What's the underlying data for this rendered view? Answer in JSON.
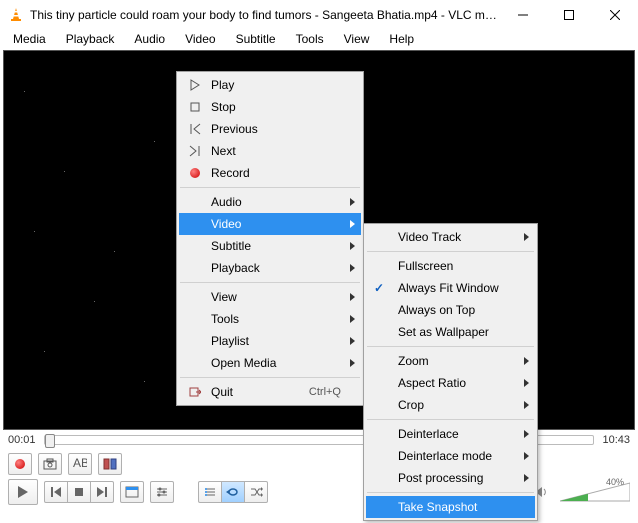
{
  "window": {
    "title": "This tiny particle could roam your body to find tumors - Sangeeta Bhatia.mp4 - VLC me..."
  },
  "menubar": [
    "Media",
    "Playback",
    "Audio",
    "Video",
    "Subtitle",
    "Tools",
    "View",
    "Help"
  ],
  "time": {
    "current": "00:01",
    "total": "10:43"
  },
  "volume": {
    "label": "40%",
    "value": 40
  },
  "context_main": {
    "items": [
      {
        "icon": "play",
        "label": "Play"
      },
      {
        "icon": "stop",
        "label": "Stop"
      },
      {
        "icon": "prev",
        "label": "Previous"
      },
      {
        "icon": "next",
        "label": "Next"
      },
      {
        "icon": "rec",
        "label": "Record"
      },
      {
        "sep": true
      },
      {
        "label": "Audio",
        "submenu": true
      },
      {
        "label": "Video",
        "submenu": true,
        "highlight": true
      },
      {
        "label": "Subtitle",
        "submenu": true
      },
      {
        "label": "Playback",
        "submenu": true
      },
      {
        "sep": true
      },
      {
        "label": "View",
        "submenu": true
      },
      {
        "label": "Tools",
        "submenu": true
      },
      {
        "label": "Playlist",
        "submenu": true
      },
      {
        "label": "Open Media",
        "submenu": true
      },
      {
        "sep": true
      },
      {
        "icon": "quit",
        "label": "Quit",
        "shortcut": "Ctrl+Q"
      }
    ]
  },
  "context_sub": {
    "items": [
      {
        "label": "Video Track",
        "submenu": true
      },
      {
        "sep": true
      },
      {
        "label": "Fullscreen"
      },
      {
        "label": "Always Fit Window",
        "checked": true
      },
      {
        "label": "Always on Top"
      },
      {
        "label": "Set as Wallpaper"
      },
      {
        "sep": true
      },
      {
        "label": "Zoom",
        "submenu": true
      },
      {
        "label": "Aspect Ratio",
        "submenu": true
      },
      {
        "label": "Crop",
        "submenu": true
      },
      {
        "sep": true
      },
      {
        "label": "Deinterlace",
        "submenu": true
      },
      {
        "label": "Deinterlace mode",
        "submenu": true
      },
      {
        "label": "Post processing",
        "submenu": true
      },
      {
        "sep": true
      },
      {
        "label": "Take Snapshot",
        "highlight": true
      }
    ]
  }
}
